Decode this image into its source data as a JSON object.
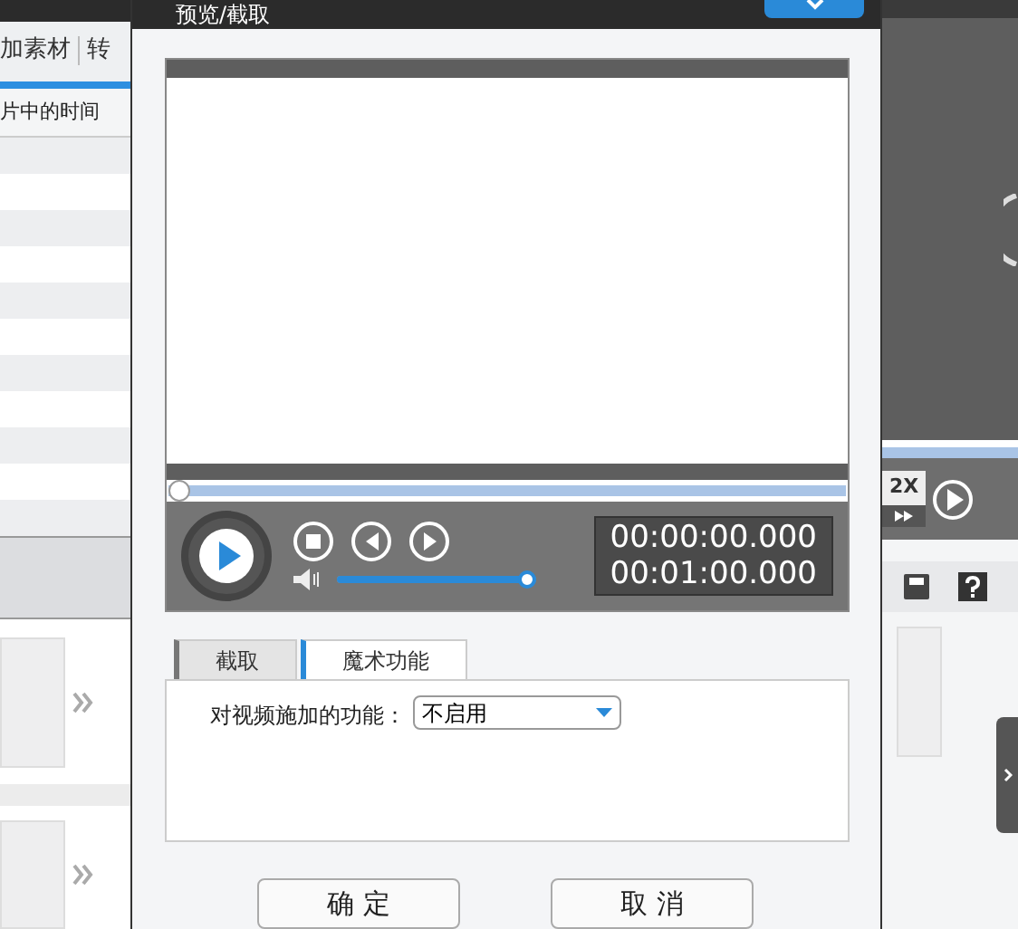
{
  "background_app": {
    "toolbar": [
      "加素材",
      "转"
    ],
    "table": {
      "column": "片中的时间"
    },
    "player": {
      "speed": "2X"
    }
  },
  "dialog": {
    "title": "预览/截取",
    "progress": {
      "level": 0
    },
    "volume": {
      "level": 1
    },
    "times": [
      "00:00:00.000",
      "00:01:00.000"
    ],
    "tabs": [
      {
        "label": "截取",
        "selected": false
      },
      {
        "label": "魔术功能",
        "selected": true
      }
    ],
    "field": {
      "label": "对视频施加的功能：",
      "value": "不启用"
    },
    "buttons": [
      "确 定",
      "取 消"
    ]
  }
}
